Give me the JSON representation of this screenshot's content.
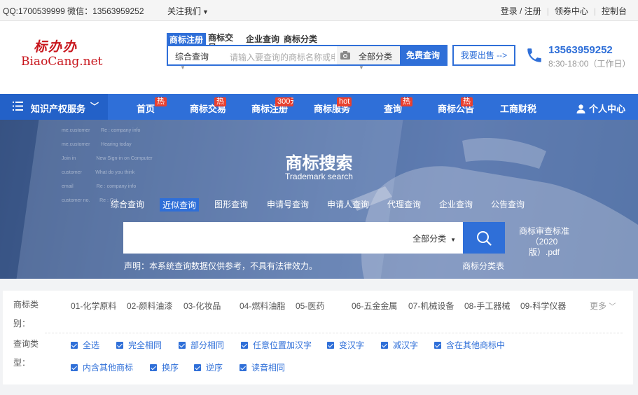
{
  "topbar": {
    "contact": "QQ:1700539999 微信：13563959252",
    "follow": "关注我们",
    "login": "登录 / 注册",
    "coupons": "领券中心",
    "console": "控制台"
  },
  "logo": {
    "cn": "标办办",
    "en": "BiaoCang.net"
  },
  "search_tabs": [
    "商标注册",
    "商标交易",
    "企业查询",
    "商标分类"
  ],
  "search": {
    "type": "综合查询",
    "placeholder": "请输入要查询的商标名称或申请号",
    "category": "全部分类",
    "button": "免费查询"
  },
  "sell_button": "我要出售 -->",
  "contact_block": {
    "phone": "13563959252",
    "hours": "8:30-18:00（工作日）"
  },
  "nav": {
    "ipr": "知识产权服务",
    "items": [
      {
        "label": "首页",
        "badge": "热"
      },
      {
        "label": "商标交易",
        "badge": "热"
      },
      {
        "label": "商标注册",
        "badge": "300元"
      },
      {
        "label": "商标服务",
        "badge": "hot"
      },
      {
        "label": "查询",
        "badge": "热"
      },
      {
        "label": "商标公告",
        "badge": "热"
      },
      {
        "label": "工商财税",
        "badge": ""
      }
    ],
    "user": "个人中心"
  },
  "hero": {
    "title": "商标搜索",
    "subtitle": "Trademark search",
    "query_types": [
      "综合查询",
      "近似查询",
      "图形查询",
      "申请号查询",
      "申请人查询",
      "代理查询",
      "企业查询",
      "公告查询"
    ],
    "active_query": "近似查询",
    "category": "全部分类",
    "pdf": "商标审查标准（2020版）.pdf",
    "notice": "声明：本系统查询数据仅供参考，不具有法律效力。",
    "class_table": "商标分类表"
  },
  "filters": {
    "class_label": "商标类别：",
    "classes": [
      "01-化学原料",
      "02-颜料油漆",
      "03-化妆品",
      "04-燃料油脂",
      "05-医药",
      "06-五金金属",
      "07-机械设备",
      "08-手工器械",
      "09-科学仪器"
    ],
    "more": "更多",
    "type_label": "查询类型：",
    "types_row1": [
      "全选",
      "完全相同",
      "部分相同",
      "任意位置加汉字",
      "变汉字",
      "减汉字",
      "含在其他商标中"
    ],
    "types_row2": [
      "内含其他商标",
      "换序",
      "逆序",
      "读音相同"
    ]
  },
  "colors": {
    "primary": "#2f6fd8",
    "badge": "#e8402f",
    "logo": "#c8161d"
  }
}
